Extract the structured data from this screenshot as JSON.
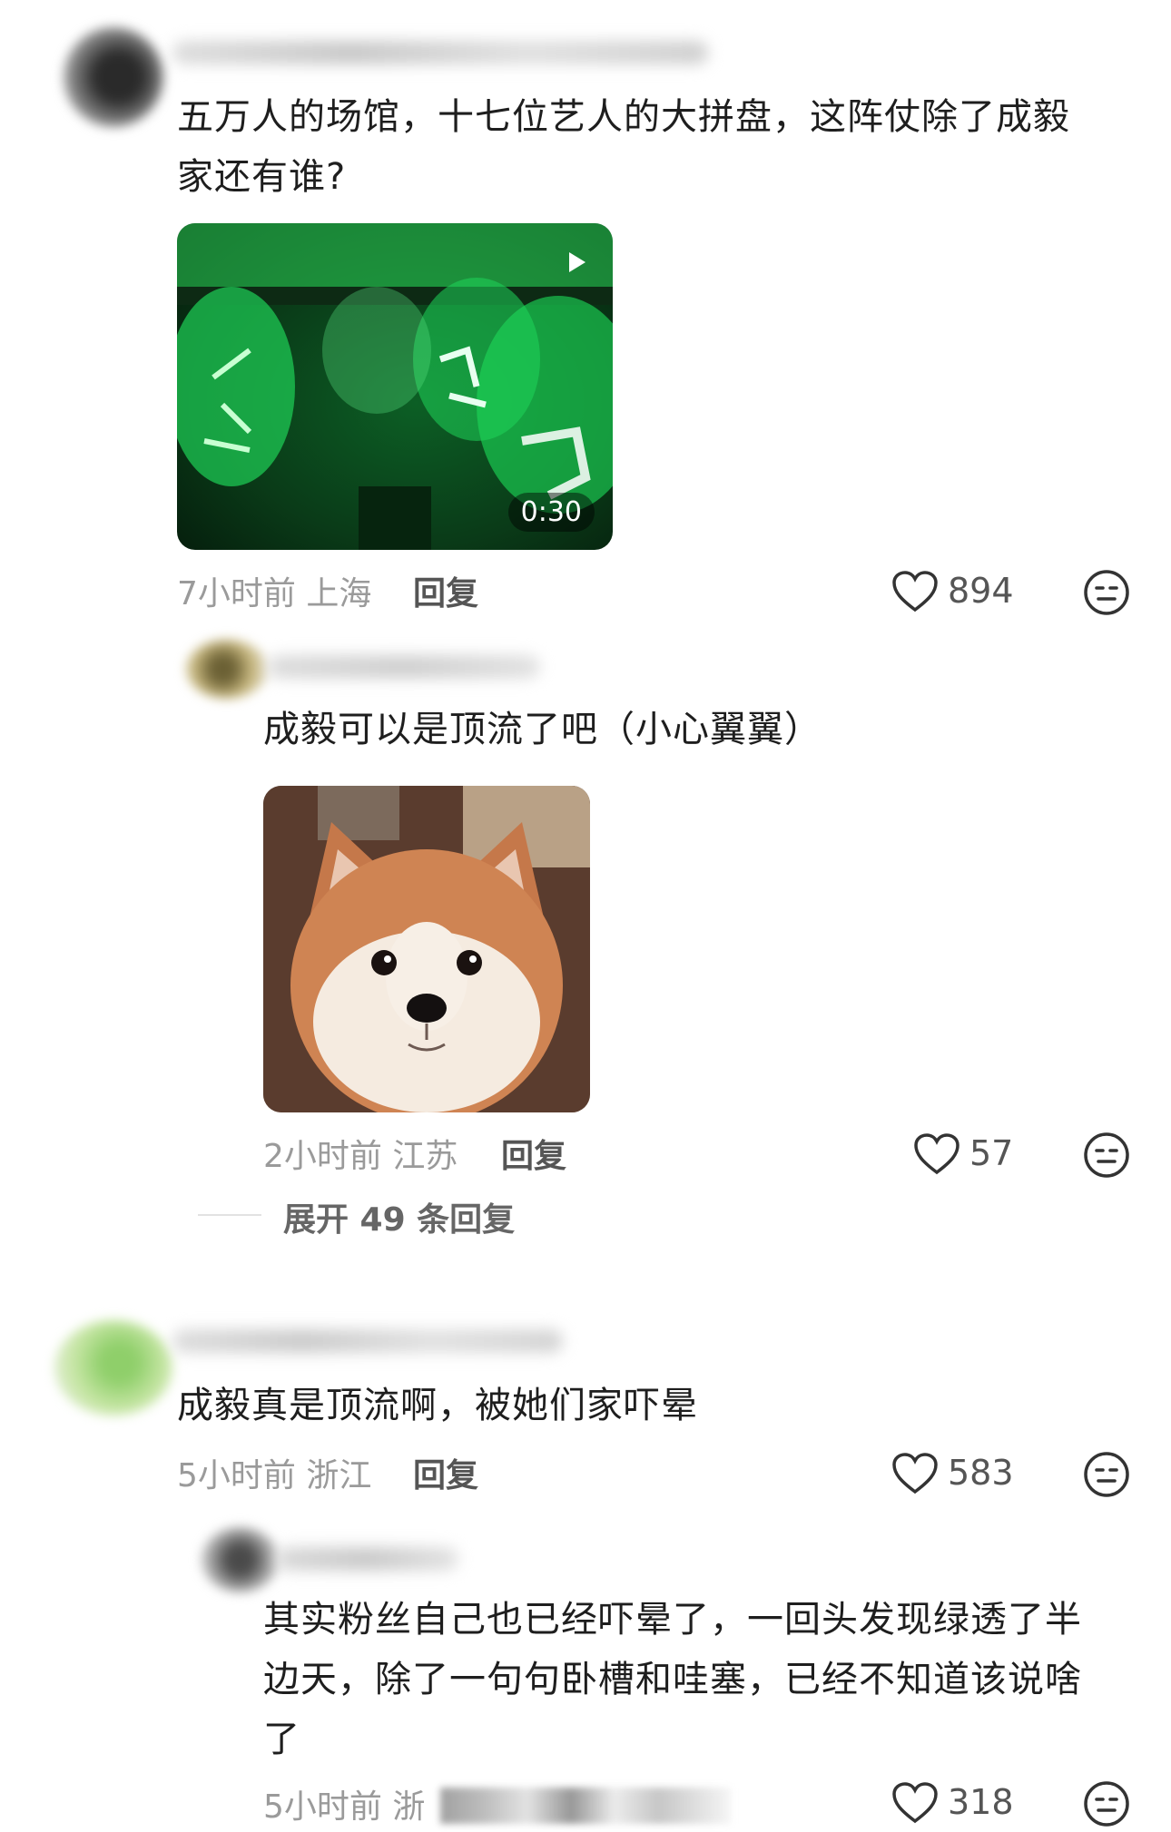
{
  "comments": [
    {
      "text": "五万人的场馆，十七位艺人的大拼盘，这阵仗除了成毅家还有谁?",
      "video_duration": "0:30",
      "time": "7小时前",
      "location": "上海",
      "reply_label": "回复",
      "likes": "894",
      "replies": [
        {
          "text": "成毅可以是顶流了吧（小心翼翼）",
          "time": "2小时前",
          "location": "江苏",
          "reply_label": "回复",
          "likes": "57"
        }
      ],
      "expand_label": "展开 49 条回复"
    },
    {
      "text": "成毅真是顶流啊，被她们家吓晕",
      "time": "5小时前",
      "location": "浙江",
      "reply_label": "回复",
      "likes": "583",
      "replies": [
        {
          "text": "其实粉丝自己也已经吓晕了，一回头发现绿透了半边天，除了一句句卧槽和哇塞，已经不知道该说啥了",
          "time": "5小时前",
          "location": "浙",
          "likes": "318"
        }
      ]
    }
  ],
  "icons": {
    "like": "heart-outline-icon",
    "react": "neutral-face-icon",
    "video": "play-icon"
  },
  "colors": {
    "video_green": "#1fd65a",
    "meta_gray": "#9a9a9a"
  }
}
